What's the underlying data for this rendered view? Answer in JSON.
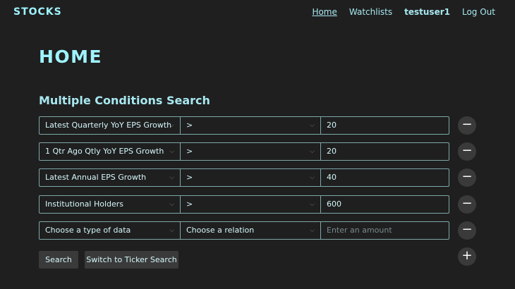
{
  "brand": "STOCKS",
  "nav": {
    "home": "Home",
    "watchlists": "Watchlists",
    "user": "testuser1",
    "logout": "Log Out"
  },
  "page_title": "HOME",
  "section_title": "Multiple Conditions Search",
  "conditions": [
    {
      "data_type": "Latest Quarterly YoY EPS Growth",
      "relation": ">",
      "amount": "20"
    },
    {
      "data_type": "1 Qtr Ago Qtly YoY EPS Growth",
      "relation": ">",
      "amount": "20"
    },
    {
      "data_type": "Latest Annual EPS Growth",
      "relation": ">",
      "amount": "40"
    },
    {
      "data_type": "Institutional Holders",
      "relation": ">",
      "amount": "600"
    },
    {
      "data_type": "Choose a type of data",
      "relation": "Choose a relation",
      "amount_placeholder": "Enter an amount"
    }
  ],
  "buttons": {
    "search": "Search",
    "switch": "Switch to Ticker Search"
  },
  "icons": {
    "remove": "minus-icon",
    "add": "plus-icon",
    "dropdown": "chevron-down-icon"
  }
}
